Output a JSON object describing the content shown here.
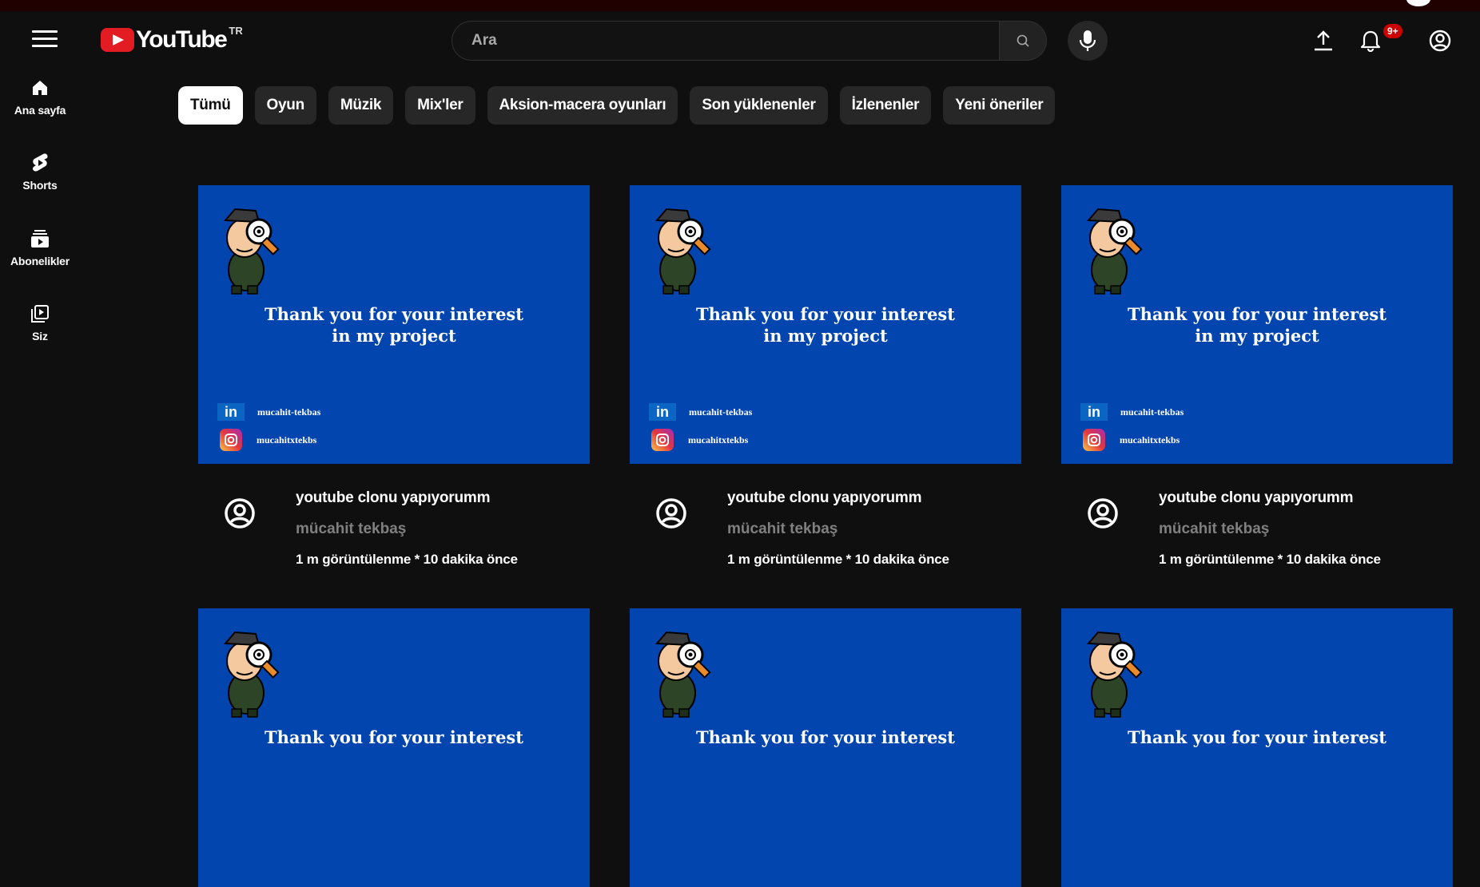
{
  "header": {
    "logo_text": "YouTube",
    "region": "TR",
    "search_placeholder": "Ara",
    "notifications_badge": "9+"
  },
  "sidebar": {
    "items": [
      {
        "label": "Ana sayfa",
        "icon": "home-icon"
      },
      {
        "label": "Shorts",
        "icon": "shorts-icon"
      },
      {
        "label": "Abonelikler",
        "icon": "subscriptions-icon"
      },
      {
        "label": "Siz",
        "icon": "library-icon"
      }
    ]
  },
  "chips": [
    "Tümü",
    "Oyun",
    "Müzik",
    "Mix'ler",
    "Aksion-macera oyunları",
    "Son yüklenenler",
    "İzlenenler",
    "Yeni öneriler"
  ],
  "videos": [
    {
      "thumb_line1": "Thank you for your interest",
      "thumb_line2": "in my project",
      "linkedin": "mucahit-tekbas",
      "instagram": "mucahitxtekbs",
      "title": "youtube clonu yapıyorumm",
      "channel": "mücahit tekbaş",
      "stats": "1 m görüntülenme * 10 dakika önce"
    },
    {
      "thumb_line1": "Thank you for your interest",
      "thumb_line2": "in my project",
      "linkedin": "mucahit-tekbas",
      "instagram": "mucahitxtekbs",
      "title": "youtube clonu yapıyorumm",
      "channel": "mücahit tekbaş",
      "stats": "1 m görüntülenme * 10 dakika önce"
    },
    {
      "thumb_line1": "Thank you for your interest",
      "thumb_line2": "in my project",
      "linkedin": "mucahit-tekbas",
      "instagram": "mucahitxtekbs",
      "title": "youtube clonu yapıyorumm",
      "channel": "mücahit tekbaş",
      "stats": "1 m görüntülenme * 10 dakika önce"
    },
    {
      "thumb_line1": "Thank you for your interest"
    },
    {
      "thumb_line1": "Thank you for your interest"
    },
    {
      "thumb_line1": "Thank you for your interest"
    }
  ],
  "colors": {
    "thumbnail_bg": "#0345af",
    "badge": "#cc0000",
    "page_bg": "#0f0f0f"
  }
}
